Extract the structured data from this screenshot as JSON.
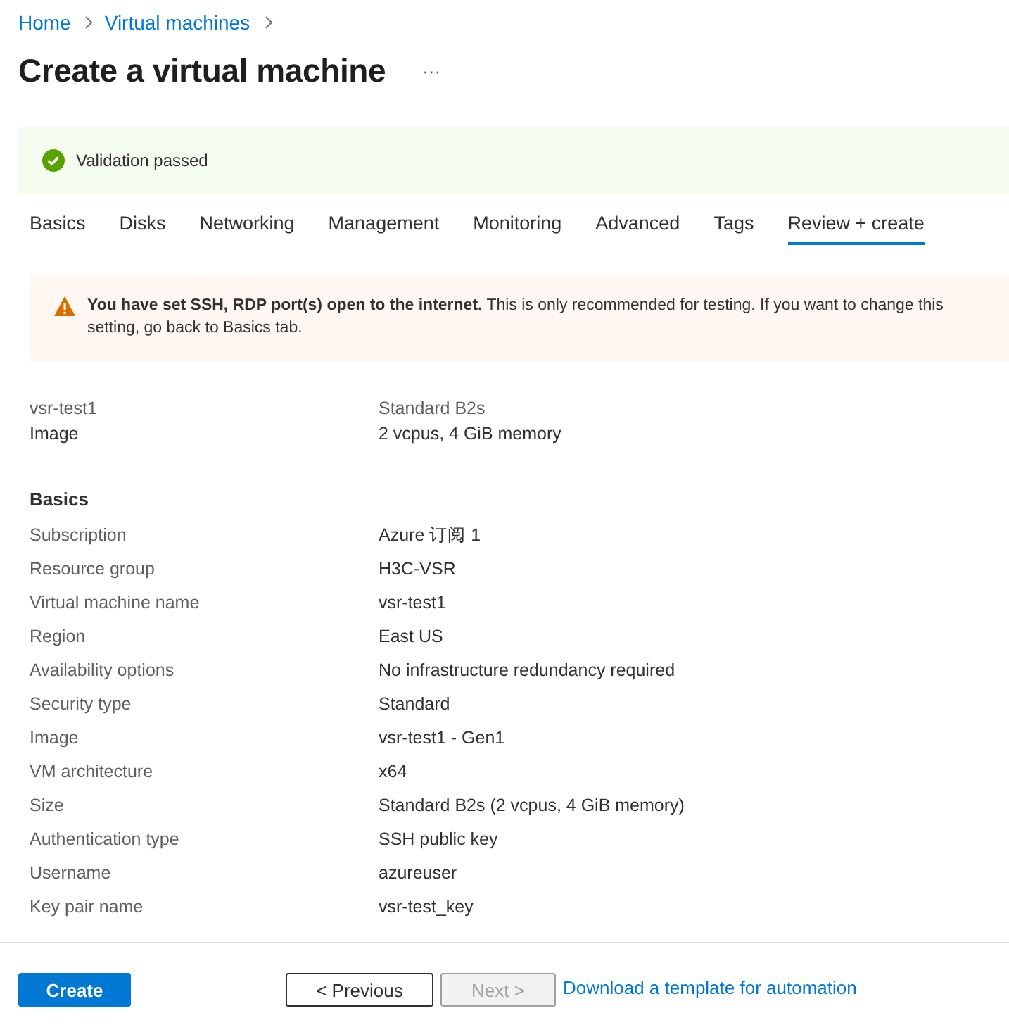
{
  "breadcrumb": [
    "Home",
    "Virtual machines"
  ],
  "title": "Create a virtual machine",
  "more": "···",
  "validation": {
    "text": "Validation passed"
  },
  "tabs": [
    {
      "label": "Basics",
      "selected": false
    },
    {
      "label": "Disks",
      "selected": false
    },
    {
      "label": "Networking",
      "selected": false
    },
    {
      "label": "Management",
      "selected": false
    },
    {
      "label": "Monitoring",
      "selected": false
    },
    {
      "label": "Advanced",
      "selected": false
    },
    {
      "label": "Tags",
      "selected": false
    },
    {
      "label": "Review + create",
      "selected": true
    }
  ],
  "warning": {
    "text": "**You have set SSH, RDP port(s) open to the internet.**  This is only recommended for testing.  If you want to change this setting, go back to Basics tab."
  },
  "summary": [
    {
      "label": "vsr-test1",
      "value": "Standard B2s",
      "muted": true
    },
    {
      "label": "Image",
      "value": "2 vcpus, 4 GiB memory",
      "muted": false
    }
  ],
  "section": {
    "heading": "Basics",
    "rows": [
      {
        "label": "Subscription",
        "value": "Azure 订阅 1"
      },
      {
        "label": "Resource group",
        "value": "H3C-VSR"
      },
      {
        "label": "Virtual machine name",
        "value": "vsr-test1"
      },
      {
        "label": "Region",
        "value": "East US"
      },
      {
        "label": "Availability options",
        "value": "No infrastructure redundancy required"
      },
      {
        "label": "Security type",
        "value": "Standard"
      },
      {
        "label": "Image",
        "value": "vsr-test1 - Gen1"
      },
      {
        "label": "VM architecture",
        "value": "x64"
      },
      {
        "label": "Size",
        "value": "Standard B2s (2 vcpus, 4 GiB memory)"
      },
      {
        "label": "Authentication type",
        "value": "SSH public key"
      },
      {
        "label": "Username",
        "value": "azureuser"
      },
      {
        "label": "Key pair name",
        "value": "vsr-test_key"
      }
    ]
  },
  "footer": [
    {
      "label": "Create",
      "kind": "primary",
      "disabled": false
    },
    {
      "label": "< Previous",
      "kind": "secondary",
      "disabled": false
    },
    {
      "label": "Next >",
      "kind": "secondary",
      "disabled": true
    },
    {
      "label": "Download a template for automation",
      "kind": "link",
      "disabled": false
    }
  ]
}
